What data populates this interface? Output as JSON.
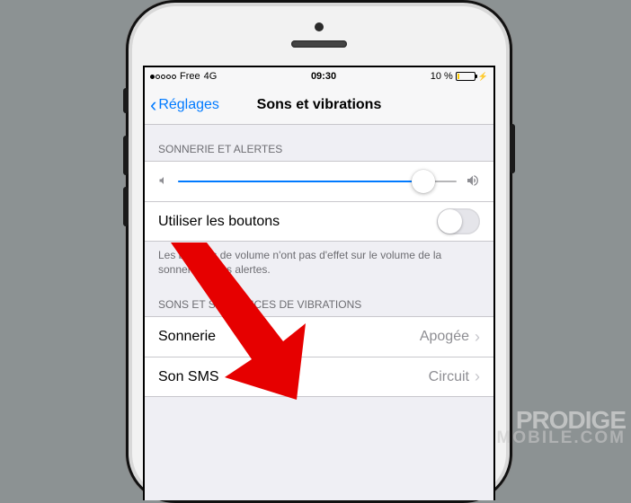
{
  "status": {
    "carrier": "Free",
    "network": "4G",
    "time": "09:30",
    "battery_pct": "10 %"
  },
  "nav": {
    "back_label": "Réglages",
    "title": "Sons et vibrations"
  },
  "sections": {
    "ringer_header": "SONNERIE ET ALERTES",
    "buttons_row": "Utiliser les boutons",
    "buttons_footer": "Les boutons de volume n'ont pas d'effet sur le volume de la sonnerie et des alertes.",
    "patterns_header": "SONS ET SÉQUENCES DE VIBRATIONS",
    "ringtone_label": "Sonnerie",
    "ringtone_value": "Apogée",
    "sms_label": "Son SMS",
    "sms_value": "Circuit"
  },
  "watermark": {
    "line1": "PRODIGE",
    "line2": "MOBILE.COM"
  }
}
